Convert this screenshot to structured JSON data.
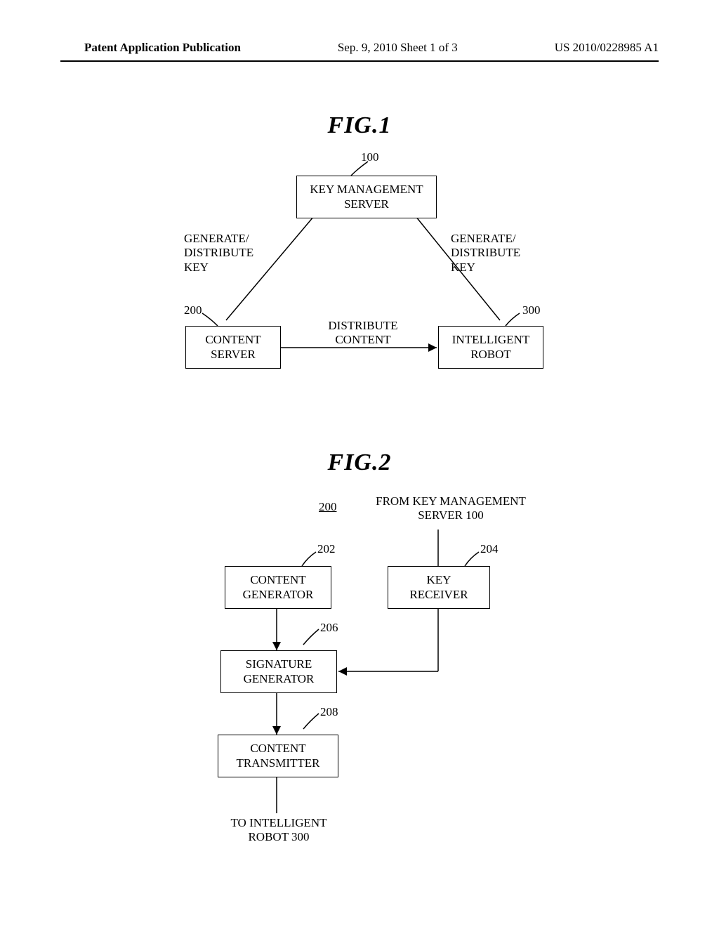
{
  "header": {
    "left": "Patent Application Publication",
    "center": "Sep. 9, 2010  Sheet 1 of 3",
    "right": "US 2010/0228985 A1"
  },
  "fig1": {
    "title": "FIG.1",
    "refs": {
      "kms": "100",
      "content_server": "200",
      "robot": "300"
    },
    "boxes": {
      "kms": "KEY MANAGEMENT\nSERVER",
      "content_server": "CONTENT\nSERVER",
      "robot": "INTELLIGENT\nROBOT"
    },
    "edges": {
      "left": "GENERATE/\nDISTRIBUTE\nKEY",
      "right": "GENERATE/\nDISTRIBUTE\nKEY",
      "bottom": "DISTRIBUTE\nCONTENT"
    }
  },
  "fig2": {
    "title": "FIG.2",
    "refs": {
      "block": "200",
      "cg": "202",
      "kr": "204",
      "sg": "206",
      "ct": "208"
    },
    "labels": {
      "from": "FROM KEY MANAGEMENT\nSERVER 100",
      "to": "TO INTELLIGENT\nROBOT 300"
    },
    "boxes": {
      "cg": "CONTENT\nGENERATOR",
      "kr": "KEY\nRECEIVER",
      "sg": "SIGNATURE\nGENERATOR",
      "ct": "CONTENT\nTRANSMITTER"
    }
  }
}
